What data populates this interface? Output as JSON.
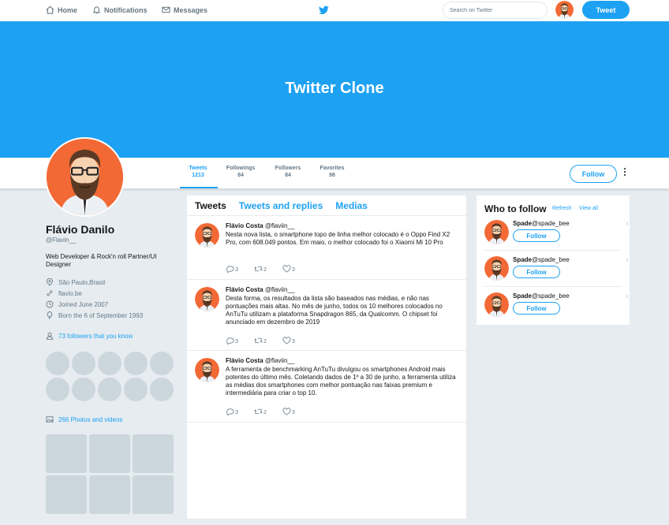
{
  "nav": {
    "home": "Home",
    "notifications": "Notifications",
    "messages": "Messages",
    "search_placeholder": "Search on Twitter",
    "tweet_button": "Tweet"
  },
  "banner": {
    "title": "Twitter Clone"
  },
  "stats": [
    {
      "label": "Tweets",
      "value": "1213"
    },
    {
      "label": "Followings",
      "value": "84"
    },
    {
      "label": "Followers",
      "value": "84"
    },
    {
      "label": "Favorites",
      "value": "98"
    }
  ],
  "profile_actions": {
    "follow": "Follow"
  },
  "profile": {
    "name": "Flávio Danilo",
    "handle": "@Flavin__",
    "bio": "Web Developer & Rock'n roll Partner/UI Designer",
    "location": "São Paulo,Brasil",
    "website": "flavio.be",
    "joined": "Joined June 2007",
    "born": "Born the 6 of September 1993",
    "followers_you_know": "73 followers that you know",
    "photos_videos": "266 Photos and videos"
  },
  "tabs": [
    "Tweets",
    "Tweets and replies",
    "Medias"
  ],
  "tweets": [
    {
      "name": "Flávio Costa",
      "handle": "@flaviin__",
      "text": "Nesta nova lista, o smartphone topo de linha melhor colocado é o Oppo Find X2 Pro, com 608.049 pontos. Em maio, o melhor colocado foi o Xiaomi Mi 10 Pro",
      "replies": "3",
      "retweets": "2",
      "likes": "3"
    },
    {
      "name": "Flávio Costa",
      "handle": "@flaviin__",
      "text": "Desta forma, os resultados da lista são baseados nas médias, e não nas pontuações mais altas. No mês de junho, todos os 10 melhores colocados no AnTuTu utilizam a plataforma Snapdragon 865, da Qualcomm. O chipset foi anunciado em dezembro de 2019",
      "replies": "3",
      "retweets": "2",
      "likes": "3"
    },
    {
      "name": "Flávio Costa",
      "handle": "@flaviin__",
      "text": "A ferramenta de benchmarking AnTuTu divulgou os smartphones Android mais potentes do último mês. Coletando dados de 1º a 30 de junho, a ferramenta utiliza as médias dos smartphones com melhor pontuação nas faixas premium e intermediária para criar o top 10.",
      "replies": "3",
      "retweets": "2",
      "likes": "3"
    }
  ],
  "who_to_follow": {
    "title": "Who to follow",
    "refresh": "Refresh",
    "view_all": "View all",
    "view_all_prefix": "·",
    "suggestions": [
      {
        "name": "Spade",
        "handle": "@spade_bee",
        "button": "Follow",
        "close": "x"
      },
      {
        "name": "Spade",
        "handle": "@spade_bee",
        "button": "Follow",
        "close": "x"
      },
      {
        "name": "Spade",
        "handle": "@spade_bee",
        "button": "Follow",
        "close": "x"
      }
    ]
  },
  "colors": {
    "accent": "#1da1f2",
    "avatar_bg": "#f26935",
    "page_bg": "#e6ecf0"
  }
}
